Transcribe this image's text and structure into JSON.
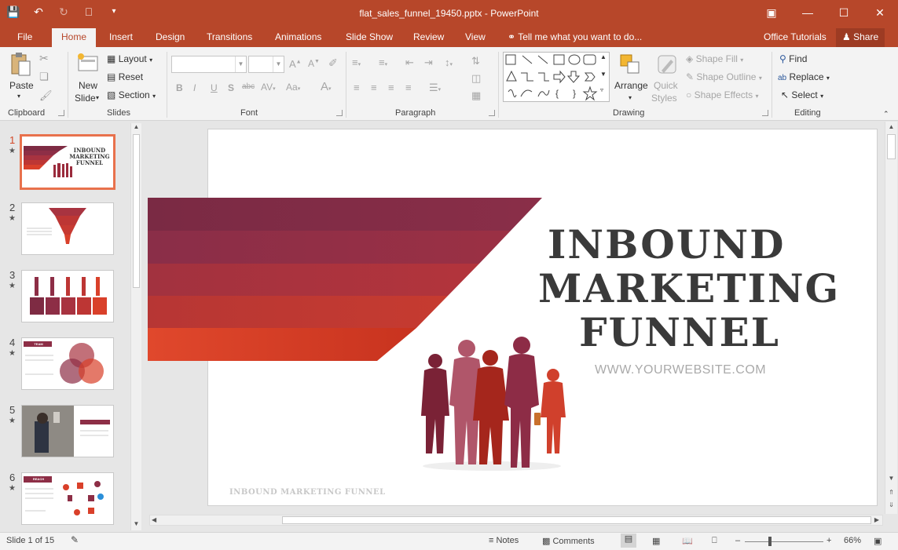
{
  "window": {
    "title": "flat_sales_funnel_19450.pptx - PowerPoint"
  },
  "tabs": [
    {
      "label": "File"
    },
    {
      "label": "Home"
    },
    {
      "label": "Insert"
    },
    {
      "label": "Design"
    },
    {
      "label": "Transitions"
    },
    {
      "label": "Animations"
    },
    {
      "label": "Slide Show"
    },
    {
      "label": "Review"
    },
    {
      "label": "View"
    }
  ],
  "tellme": "Tell me what you want to do...",
  "office_tutorials": "Office Tutorials",
  "share": "Share",
  "ribbon": {
    "clipboard": {
      "label": "Clipboard",
      "paste": "Paste"
    },
    "slides": {
      "label": "Slides",
      "new_slide_1": "New",
      "new_slide_2": "Slide",
      "layout": "Layout",
      "reset": "Reset",
      "section": "Section"
    },
    "font": {
      "label": "Font"
    },
    "paragraph": {
      "label": "Paragraph"
    },
    "drawing": {
      "label": "Drawing",
      "arrange": "Arrange",
      "quick_1": "Quick",
      "quick_2": "Styles",
      "shape_fill": "Shape Fill",
      "shape_outline": "Shape Outline",
      "shape_effects": "Shape Effects"
    },
    "editing": {
      "label": "Editing",
      "find": "Find",
      "replace": "Replace",
      "select": "Select"
    }
  },
  "thumbnails": [
    {
      "num": "1",
      "title": "INBOUND MARKETING FUNNEL"
    },
    {
      "num": "2"
    },
    {
      "num": "3"
    },
    {
      "num": "4",
      "title": "TEAM"
    },
    {
      "num": "5"
    },
    {
      "num": "6",
      "title": "REACH"
    }
  ],
  "slide": {
    "title_line1": "INBOUND",
    "title_line2": "MARKETING",
    "title_line3": "FUNNEL",
    "website": "WWW.YOURWEBSITE.COM",
    "footer": "INBOUND MARKETING FUNNEL"
  },
  "status": {
    "slide_info": "Slide 1 of 15",
    "notes": "Notes",
    "comments": "Comments",
    "zoom": "66%"
  },
  "colors": {
    "accent": "#b7472a",
    "band1": "#7e2b43",
    "band2": "#8d2e46",
    "band3": "#a83340",
    "band4": "#bd3634",
    "band5": "#d9402a",
    "title": "#3a3a3a"
  }
}
